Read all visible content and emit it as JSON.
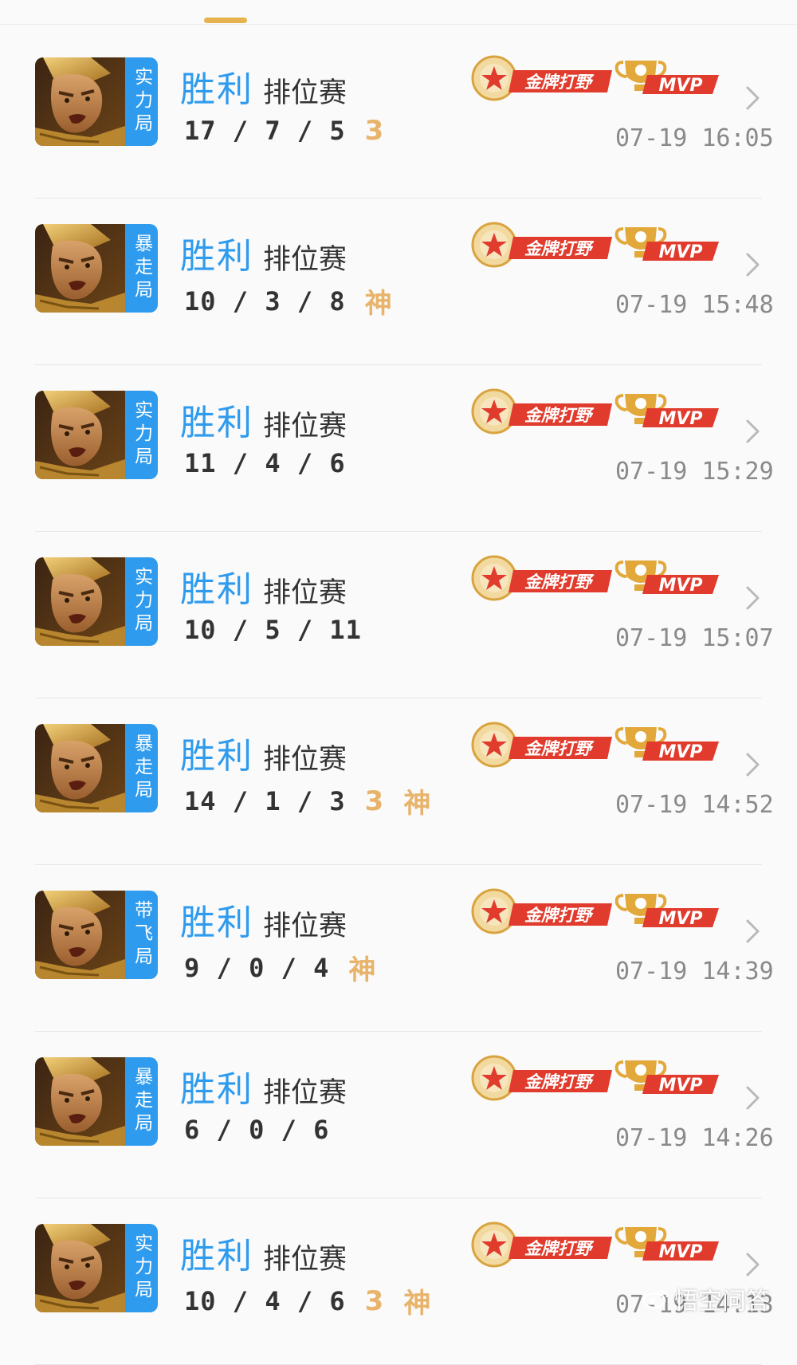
{
  "colors": {
    "result_blue": "#2f9bee",
    "tag_gold": "#e8b36a",
    "mvp_red": "#e03b2c",
    "gold": "#e2a83a"
  },
  "badges": {
    "medal_label": "金牌打野",
    "mvp_label": "MVP"
  },
  "matches": [
    {
      "mode": "实力局",
      "result": "胜利",
      "type": "排位赛",
      "kda": "17 / 7 / 5",
      "tags": [
        "3"
      ],
      "time": "07-19 16:05"
    },
    {
      "mode": "暴走局",
      "result": "胜利",
      "type": "排位赛",
      "kda": "10 / 3 / 8",
      "tags": [
        "神"
      ],
      "time": "07-19 15:48"
    },
    {
      "mode": "实力局",
      "result": "胜利",
      "type": "排位赛",
      "kda": "11 / 4 / 6",
      "tags": [],
      "time": "07-19 15:29"
    },
    {
      "mode": "实力局",
      "result": "胜利",
      "type": "排位赛",
      "kda": "10 / 5 / 11",
      "tags": [],
      "time": "07-19 15:07"
    },
    {
      "mode": "暴走局",
      "result": "胜利",
      "type": "排位赛",
      "kda": "14 / 1 / 3",
      "tags": [
        "3",
        "神"
      ],
      "time": "07-19 14:52"
    },
    {
      "mode": "带飞局",
      "result": "胜利",
      "type": "排位赛",
      "kda": "9 / 0 / 4",
      "tags": [
        "神"
      ],
      "time": "07-19 14:39"
    },
    {
      "mode": "暴走局",
      "result": "胜利",
      "type": "排位赛",
      "kda": "6 / 0 / 6",
      "tags": [],
      "time": "07-19 14:26"
    },
    {
      "mode": "实力局",
      "result": "胜利",
      "type": "排位赛",
      "kda": "10 / 4 / 6",
      "tags": [
        "3",
        "神"
      ],
      "time": "07-19 14:13"
    }
  ],
  "watermark": "悟空问答"
}
